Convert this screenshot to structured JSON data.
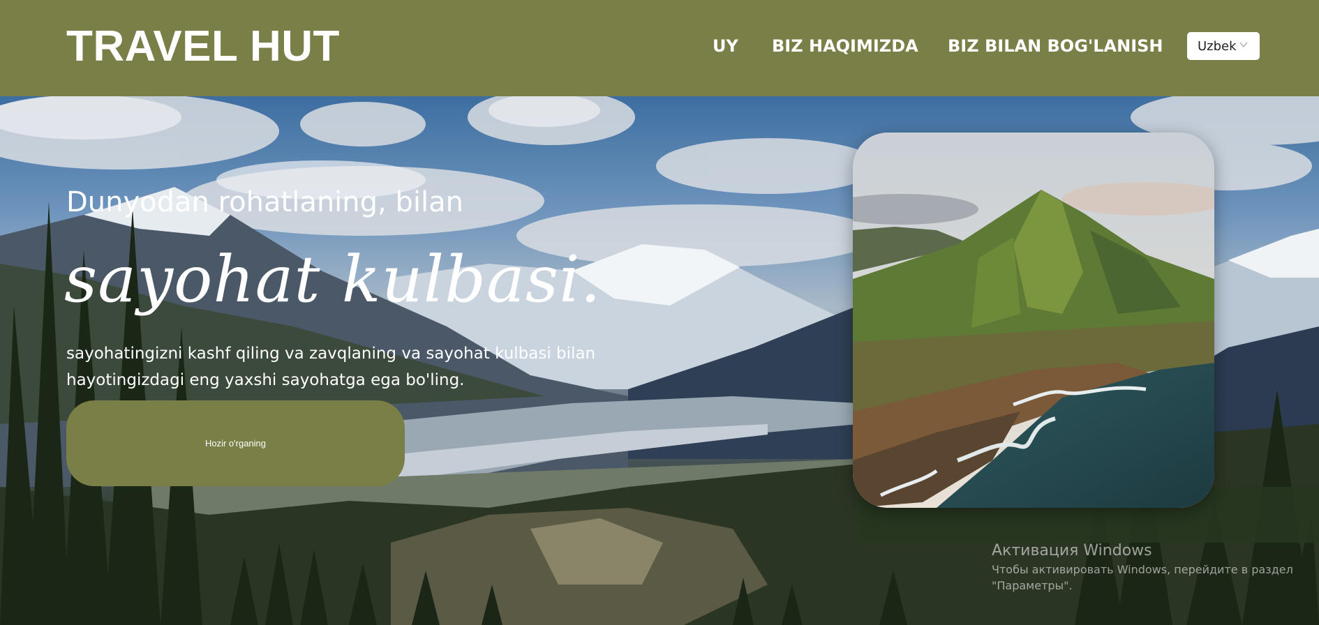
{
  "header": {
    "logo": "TRAVEL HUT",
    "nav": [
      {
        "label": "UY"
      },
      {
        "label": "BIZ HAQIMIZDA"
      },
      {
        "label": "BIZ BILAN BOG'LANISH"
      }
    ],
    "language": {
      "selected": "Uzbek",
      "icon": "chevron-down-icon"
    }
  },
  "hero": {
    "subtitle": "Dunyodan rohatlaning, bilan",
    "title": "sayohat kulbasi.",
    "description": "sayohatingizni kashf qiling va zavqlaning va sayohat kulbasi bilan hayotingizdagi eng yaxshi sayohatga ega bo'ling.",
    "cta_label": "Hozir o'rganing",
    "background_image": "mountain valley with snowy peaks, clouds and pine forest",
    "card_image": "green volcanic mountain above a rocky ocean coastline"
  },
  "watermark": {
    "title": "Активация Windows",
    "line1": "Чтобы активировать Windows, перейдите в раздел",
    "line2": "\"Параметры\"."
  },
  "colors": {
    "brand_olive": "#7a7f48",
    "text_white": "#ffffff",
    "select_bg": "#ffffff"
  }
}
